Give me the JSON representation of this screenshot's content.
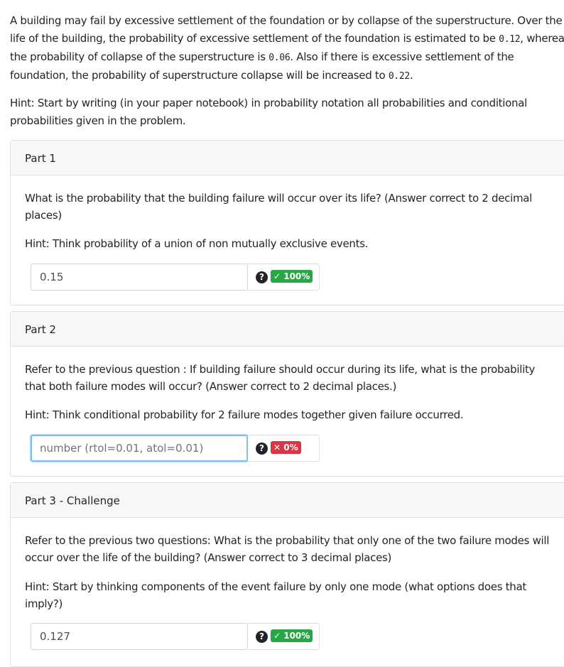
{
  "problem": {
    "text_1": "A building may fail by excessive settlement of the foundation or by collapse of the superstructure. Over the life of the building, the probability of excessive settlement of the foundation is estimated to be ",
    "value_1": "0.12",
    "text_2": ", whereas the probability of collapse of the superstructure is ",
    "value_2": "0.06",
    "text_3": ". Also if there is excessive settlement of the foundation, the probability of superstructure collapse will be increased to ",
    "value_3": "0.22",
    "text_4": ".",
    "hint": "Hint: Start by writing (in your paper notebook) in probability notation all probabilities and conditional probabilities given in the problem."
  },
  "parts": [
    {
      "title": "Part 1",
      "question": "What is the probability that the building failure will occur over its life? (Answer correct to 2 decimal places)",
      "hint": "Hint: Think probability of a union of non mutually exclusive events.",
      "value": "0.15",
      "placeholder": "",
      "help_icon": "question-circle-icon",
      "badge_icon": "check",
      "badge": "✓ 100%"
    },
    {
      "title": "Part 2",
      "question": "Refer to the previous question : If building failure should occur during its life, what is the probability that both failure modes will occur? (Answer correct to 2 decimal places.)",
      "hint": "Hint: Think conditional probability for 2 failure modes together given failure occurred.",
      "value": "",
      "placeholder": "number (rtol=0.01, atol=0.01)",
      "help_icon": "question-circle-icon",
      "badge_icon": "times",
      "badge": "✕ 0%"
    },
    {
      "title": "Part 3 - Challenge",
      "question": "Refer to the previous two questions: What is the probability that only one of the two failure modes will occur over the life of the building? (Answer correct to 3 decimal places)",
      "hint": "Hint: Start by thinking components of the event failure by only one mode (what options does that imply?)",
      "value": "0.127",
      "placeholder": "",
      "help_icon": "question-circle-icon",
      "badge_icon": "check",
      "badge": "✓ 100%"
    }
  ],
  "colors": {
    "correct": "#28a745",
    "incorrect": "#dc3545",
    "focus": "#80bdff",
    "card_header_bg": "#f7f7f7"
  }
}
